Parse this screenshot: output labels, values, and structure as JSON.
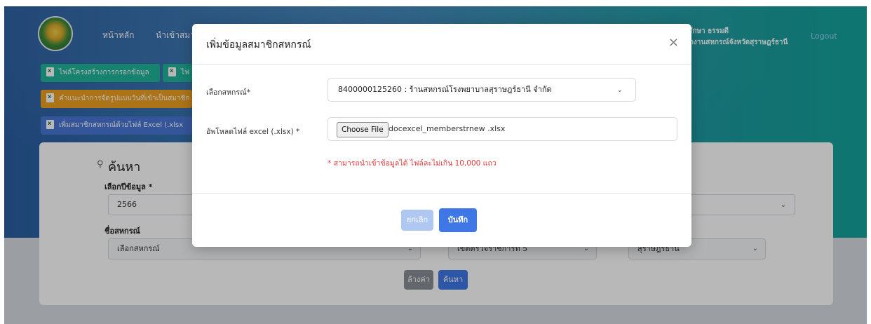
{
  "header": {
    "nav": [
      "หน้าหลัก",
      "นำเข้าสมาชิ"
    ],
    "user_name": "อรักษา ธรรมดี",
    "user_org": "นักงานสหกรณ์จังหวัดสุราษฎร์ธานี",
    "logout": "Logout"
  },
  "toolbar": {
    "structure_file": "ไฟล์โครงสร้างการกรอกข้อมูล",
    "file2": "ไฟ",
    "guide": "คำแนะนำการจัดรูปแบบวันที่เข้าเป็นสมาชิก ค",
    "import_excel": "เพิ่มสมาชิกสหกรณ์ด้วยไฟล์ Excel (.xlsx"
  },
  "search_panel": {
    "title": "ค้นหา",
    "year_label": "เลือกปีข้อมูล *",
    "year_value": "2566",
    "coop_label": "ชื่อสหกรณ์",
    "coop_value": "เลือกสหกรณ์",
    "region_value": "เขตตรวจราชการที่ 5",
    "province_value": "สุราษฎร์ธานี",
    "clear_button": "ล้างค่า",
    "search_button": "ค้นหา"
  },
  "modal": {
    "title": "เพิ่มข้อมูลสมาชิกสหกรณ์",
    "close": "×",
    "coop_label": "เลือกสหกรณ์*",
    "coop_value": "8400000125260 : ร้านสหกรณ์โรงพยาบาลสุราษฎร์ธานี จำกัด",
    "upload_label": "อัพโหลดไฟล์ excel (.xlsx) *",
    "choose_file": "Choose File",
    "file_name": "docexcel_memberstrnew .xlsx",
    "note": "* สามารถนำเข้าข้อมูลได้ ไฟล์ละไม่เกิน 10,000 แถว",
    "cancel": "ยกเลิก",
    "save": "บันทึก"
  },
  "colors": {
    "primary": "#3f78e6",
    "teal_button": "#1fb59a",
    "warning_button": "#f0a020",
    "excel_button": "#4a76d6",
    "note_red": "#e23d3d"
  },
  "icons": {
    "chevron": "chevron-down-icon",
    "search": "search-icon",
    "excel": "excel-file-icon",
    "close": "close-icon"
  }
}
